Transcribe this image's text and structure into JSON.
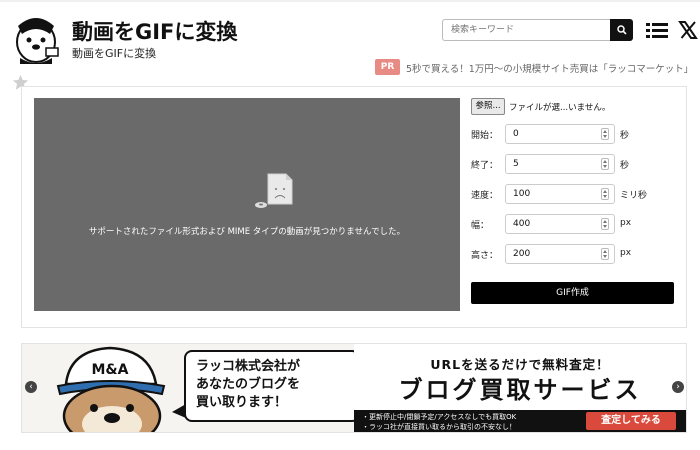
{
  "header": {
    "title": "動画をGIFに変換",
    "subtitle": "動画をGIFに変換",
    "search_placeholder": "検索キーワード"
  },
  "promo": {
    "badge": "PR",
    "text": "5秒で買える！1万円〜の小規模サイト売買は「ラッコマーケット」"
  },
  "player": {
    "message": "サポートされたファイル形式および MIME タイプの動画が見つかりませんでした。"
  },
  "form": {
    "file_button": "参照...",
    "file_status": "ファイルが選...いません。",
    "fields": [
      {
        "label": "開始：",
        "value": "0",
        "unit": "秒"
      },
      {
        "label": "終了：",
        "value": "5",
        "unit": "秒"
      },
      {
        "label": "速度：",
        "value": "100",
        "unit": "ミリ秒"
      },
      {
        "label": "幅：",
        "value": "400",
        "unit": "px"
      },
      {
        "label": "高さ：",
        "value": "200",
        "unit": "px"
      }
    ],
    "submit": "GIF作成"
  },
  "banner": {
    "cap_text": "M&A",
    "bubble_text": "ラッコ株式会社が\nあなたのブログを\n買い取ります！",
    "headline": "URLを送るだけで無料査定！",
    "title": "ブログ買取サービス",
    "note1": "・更新停止中/閉鎖予定/アクセスなしでも買取OK",
    "note2": "・ラッコ社が直接買い取るから取引の不安なし！",
    "cta": "査定してみる",
    "prev_arrow": "‹",
    "next_arrow": "›"
  },
  "icons": {
    "logo": "otter-logo-icon",
    "search": "search-icon",
    "menu": "hamburger-menu-icon",
    "x": "x-social-icon",
    "star": "star-icon",
    "file": "broken-file-icon"
  },
  "colors": {
    "pr_badge": "#e88b84",
    "video_bg": "#6a6a6a",
    "button": "#000000",
    "cta": "#d94a3d"
  }
}
